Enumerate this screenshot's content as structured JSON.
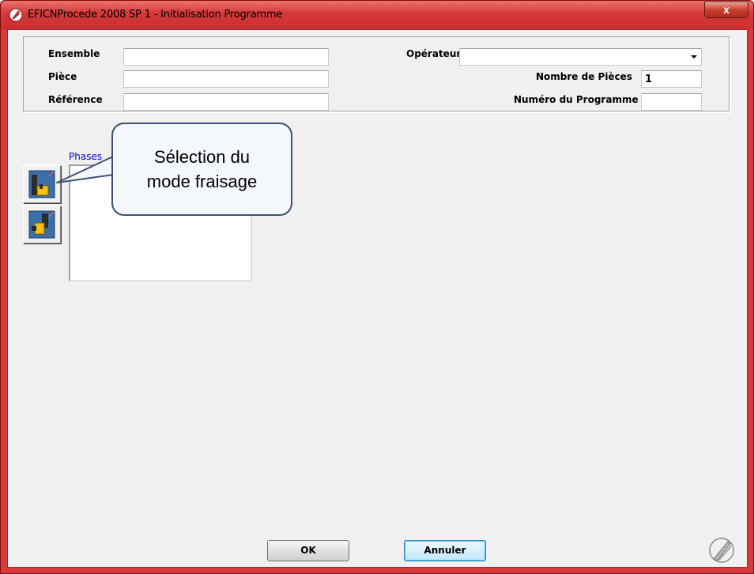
{
  "window": {
    "title": "EFICNProcede 2008 SP 1 - Initialisation Programme",
    "close_label": "x"
  },
  "form": {
    "ensemble_label": "Ensemble",
    "ensemble_value": "",
    "piece_label": "Pièce",
    "piece_value": "",
    "reference_label": "Référence",
    "reference_value": "",
    "operateur_label": "Opérateur",
    "operateur_value": "",
    "nb_pieces_label": "Nombre de Pièces",
    "nb_pieces_value": "1",
    "num_programme_label": "Numéro du Programme",
    "num_programme_value": ""
  },
  "phases": {
    "label": "Phases",
    "items": []
  },
  "callout": {
    "line1": "Sélection du",
    "line2": "mode fraisage"
  },
  "footer": {
    "ok_label": "OK",
    "cancel_label": "Annuler"
  },
  "colors": {
    "frame": "#d63a3a",
    "phases_label": "#0000cc",
    "callout_border": "#3d5170"
  }
}
